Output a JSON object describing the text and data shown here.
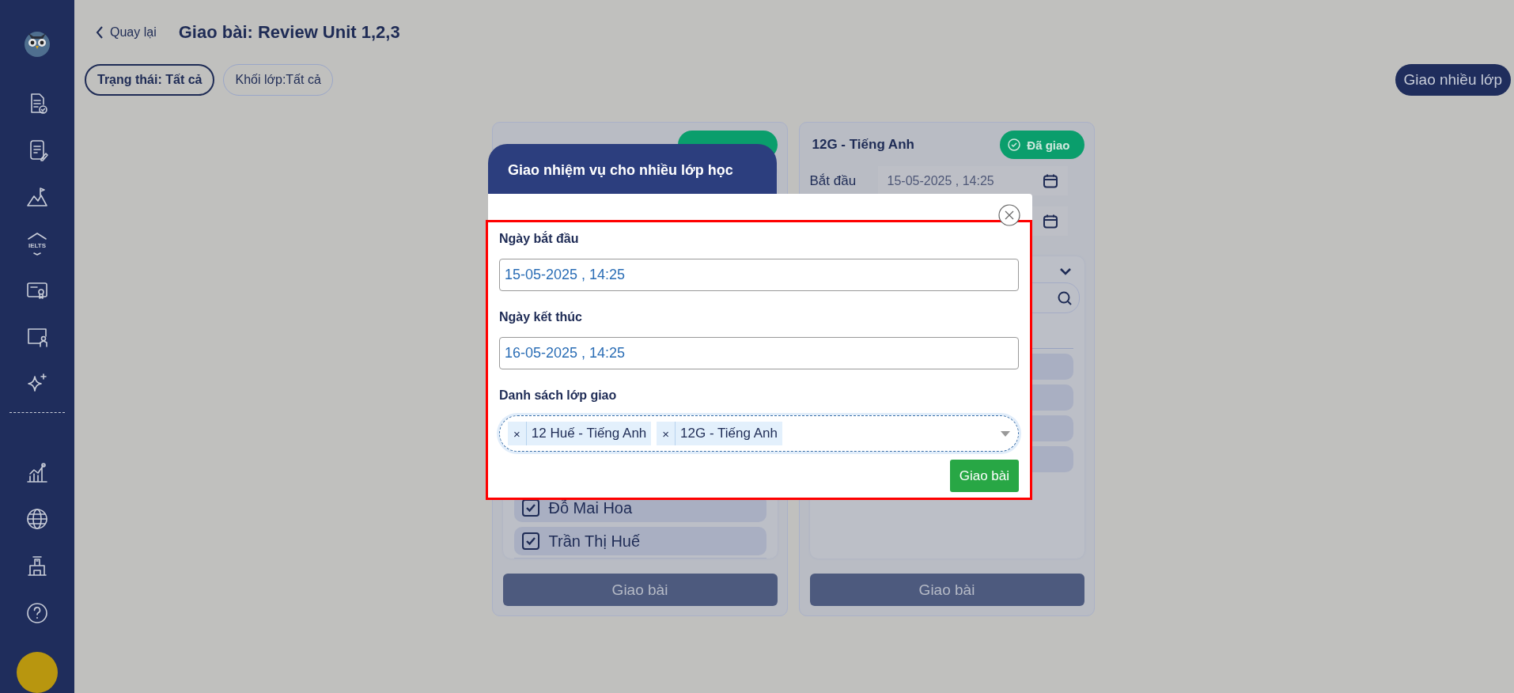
{
  "sidebar": {
    "ielts_icon_text": "IELTS"
  },
  "header": {
    "back_link": "Quay lại",
    "title": "Giao bài: Review Unit 1,2,3"
  },
  "filters": [
    {
      "label": "Trạng thái: Tất cả",
      "selected": true
    },
    {
      "label": "Khối lớp:Tất cả",
      "selected": false
    }
  ],
  "assign_many_button": "Giao nhiều lớp",
  "class_cards": [
    {
      "kind": "students",
      "students": [
        {
          "name": "Đỗ Mai Hoa",
          "checked": true
        },
        {
          "name": "Trần Thị Huế",
          "checked": true
        }
      ],
      "button": "Giao bài"
    },
    {
      "kind": "schedule",
      "title": "12G - Tiếng Anh",
      "status": "Đã giao",
      "start_label": "Bắt đầu",
      "start_value": "15-05-2025 , 14:25",
      "button": "Giao bài"
    }
  ],
  "modal": {
    "title": "Giao nhiệm vụ cho nhiều lớp học",
    "fields": [
      {
        "label": "Ngày bắt đầu",
        "value": "15-05-2025 , 14:25"
      },
      {
        "label": "Ngày kết thúc",
        "value": "16-05-2025 , 14:25"
      }
    ],
    "classes_label": "Danh sách lớp giao",
    "tags": [
      {
        "remove": "×",
        "label": "12 Huế - Tiếng Anh"
      },
      {
        "remove": "×",
        "label": "12G - Tiếng Anh"
      }
    ],
    "submit": "Giao bài"
  }
}
